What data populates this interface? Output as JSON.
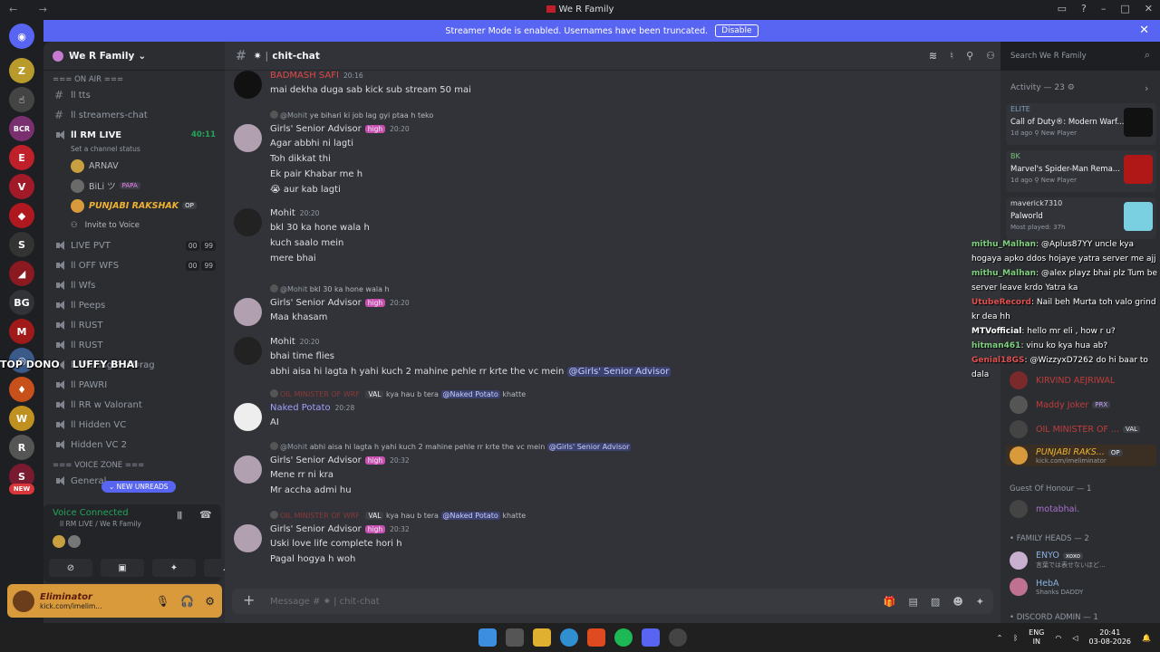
{
  "window": {
    "title": "We R Family",
    "nav": "← →"
  },
  "banner": {
    "text": "Streamer Mode is enabled. Usernames have been truncated.",
    "button": "Disable"
  },
  "server": {
    "name": "We R Family",
    "category_onair": "=== ON AIR ===",
    "category_voice": "=== VOICE ZONE ===",
    "channels": [
      {
        "name": "ll tts"
      },
      {
        "name": "ll streamers-chat"
      },
      {
        "name": "ll RM LIVE",
        "timer": "40:11",
        "status": "Set a channel status"
      },
      {
        "name": "LIVE PVT",
        "b1": "00",
        "b2": "99"
      },
      {
        "name": "ll OFF WFS",
        "b1": "00",
        "b2": "99"
      },
      {
        "name": "ll Wfs"
      },
      {
        "name": "ll Peeps"
      },
      {
        "name": "ll RUST"
      },
      {
        "name": "ll RUST"
      },
      {
        "name": "ll Waiting For Drag"
      },
      {
        "name": "ll PAWRI"
      },
      {
        "name": "ll RR w Valorant"
      },
      {
        "name": "ll Hidden VC"
      },
      {
        "name": "Hidden VC 2"
      },
      {
        "name": "General"
      }
    ],
    "voice_users": [
      {
        "name": "ARNAV"
      },
      {
        "name": "BiLi ツ",
        "tag": "PAPA"
      },
      {
        "name": "PUNJABI RAKSHAK",
        "tag": "OP"
      },
      {
        "name": "Invite to Voice"
      }
    ],
    "overlay_left": "TOP DONO",
    "overlay_right": "LUFFY BHAI",
    "new_unreads": "NEW UNREADS",
    "new_badge": "NEW",
    "bg_label": "BG"
  },
  "voice": {
    "status": "Voice Connected",
    "channel": "ll RM LIVE / We R Family"
  },
  "user": {
    "name": "Eliminator",
    "status": "kick.com/imelim..."
  },
  "channel": {
    "name": "chit-chat",
    "search_placeholder": "Search We R Family",
    "composer_placeholder": "Message # ✷ | chit-chat"
  },
  "messages": [
    {
      "author": "BADMASH SAFI",
      "time": "20:16",
      "lines": [
        "mai dekha duga sab kick sub stream 50 mai"
      ]
    },
    {
      "reply_to": "@Mohit",
      "reply_text": "ye bihari ki job lag gyi ptaa h teko",
      "author": "Girls' Senior Advisor",
      "role": "high",
      "time": "20:20",
      "lines": [
        "Agar abbhi ni lagti",
        "Toh dikkat thi",
        "Ek pair Khabar me h",
        "😭 aur kab lagti"
      ]
    },
    {
      "author": "Mohit",
      "time": "20:20",
      "lines": [
        "bkl 30 ka hone wala h",
        "kuch saalo mein",
        "mere bhai"
      ]
    },
    {
      "reply_to": "@Mohit",
      "reply_text": "bkl 30 ka hone wala h",
      "author": "Girls' Senior Advisor",
      "role": "high",
      "time": "20:20",
      "lines": [
        "Maa khasam"
      ]
    },
    {
      "author": "Mohit",
      "time": "20:20",
      "lines": [
        "bhai time flies",
        "abhi aisa hi lagta h yahi kuch 2 mahine pehle rr krte the vc mein"
      ],
      "mention": "@Girls' Senior Advisor"
    },
    {
      "reply_to": "OIL MINISTER OF WRF",
      "reply_tag": "VAL",
      "reply_text": "kya hau b tera",
      "reply_mention": "@Naked Potato",
      "reply_tail": "khatte",
      "author": "Naked Potato",
      "time": "20:28",
      "lines": [
        "AI"
      ]
    },
    {
      "reply_to": "@Mohit",
      "reply_text": "abhi aisa hi lagta h yahi kuch 2 mahine pehle rr krte the vc mein",
      "reply_mention": "@Girls' Senior Advisor",
      "author": "Girls' Senior Advisor",
      "role": "high",
      "time": "20:32",
      "lines": [
        "Mene rr ni kra",
        "Mr accha admi hu"
      ]
    },
    {
      "reply_to": "OIL MINISTER OF WRF",
      "reply_tag": "VAL",
      "reply_text": "kya hau b tera",
      "reply_mention": "@Naked Potato",
      "reply_tail": "khatte",
      "author": "Girls' Senior Advisor",
      "role": "high",
      "time": "20:32",
      "lines": [
        "Uski love life complete hori h",
        "Pagal hogya h woh"
      ]
    }
  ],
  "activity": {
    "title": "Activity — 23",
    "cards": [
      {
        "who": "ELITE",
        "game": "Call of Duty®: Modern Warf...",
        "meta": "1d ago  ⚲ New Player"
      },
      {
        "who": "BK",
        "game": "Marvel's Spider-Man Rema...",
        "meta": "1d ago  ⚲ New Player"
      },
      {
        "who": "maverick7310",
        "game": "Palworld",
        "meta": "Most played: 37h"
      }
    ]
  },
  "overlay_chat": [
    {
      "user": "mithu_Malhan",
      "text": "@Aplus87YY uncle kya hogaya apko ddos hojaye yatra server me ajj"
    },
    {
      "user": "mithu_Malhan",
      "text": "@alex playz bhai plz Tum be server leave krdo Yatra ka"
    },
    {
      "user": "UtubeRecord",
      "text": "Nail beh Murta toh valo grind kr dea hh"
    },
    {
      "user": "MTVofficial",
      "text": "hello mr eli , how r u?"
    },
    {
      "user": "hitman461",
      "text": "vinu ko kya hua ab?"
    },
    {
      "user": "Genial18GS",
      "text": "@WizzyxD7262 do hi baar to dala"
    }
  ],
  "members": [
    {
      "name": "KIRVIND AEJRIWAL"
    },
    {
      "name": "Maddy Joker",
      "tag": "PRX"
    },
    {
      "name": "OIL MINISTER OF ...",
      "tag": "VAL"
    },
    {
      "name": "PUNJABI RAKS...",
      "tag": "OP",
      "sub": "kick.com/imeliminator"
    }
  ],
  "sections": {
    "guest": "Guest Of Honour — 1",
    "guest_member": "motabhai.",
    "family": "• FAMILY HEADS — 2",
    "enyo": "ENYO",
    "enyo_tag": "xoxo",
    "enyo_sub": "言葉では表せないほど...",
    "heba": "HebA",
    "heba_sub": "Shanks DADDY",
    "admin": "• DISCORD ADMIN — 1"
  },
  "taskbar": {
    "lang1": "ENG",
    "lang2": "IN",
    "time": "20:41",
    "date": "03-08-2026"
  }
}
